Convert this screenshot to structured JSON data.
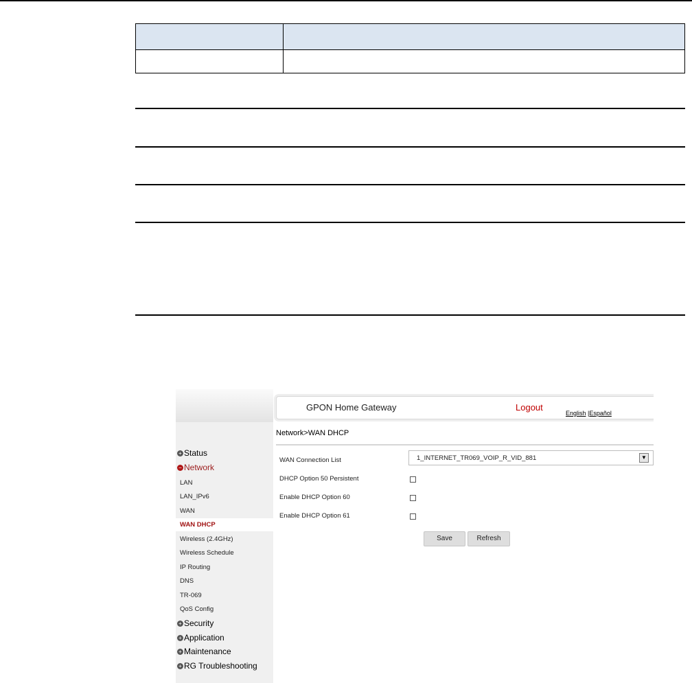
{
  "app": {
    "title": "GPON Home Gateway",
    "logout": "Logout",
    "lang_english": "English",
    "lang_sep": " |",
    "lang_espanol": "Español"
  },
  "breadcrumb": "Network>WAN DHCP",
  "nav": {
    "status": "Status",
    "network": "Network",
    "network_items": [
      "LAN",
      "LAN_IPv6",
      "WAN",
      "WAN DHCP",
      "Wireless (2.4GHz)",
      "Wireless Schedule",
      "IP Routing",
      "DNS",
      "TR-069",
      "QoS Config"
    ],
    "security": "Security",
    "application": "Application",
    "maintenance": "Maintenance",
    "rg_troubleshooting": "RG Troubleshooting"
  },
  "form": {
    "wan_connection_label": "WAN Connection List",
    "wan_connection_value": "1_INTERNET_TR069_VOIP_R_VID_881",
    "opt50_label": "DHCP Option 50 Persistent",
    "opt60_label": "Enable DHCP Option 60",
    "opt61_label": "Enable DHCP Option 61",
    "opt50_checked": false,
    "opt60_checked": false,
    "opt61_checked": false
  },
  "buttons": {
    "save": "Save",
    "refresh": "Refresh"
  },
  "colors": {
    "accent": "#c00000",
    "active_nav": "#a01212",
    "table_header": "#dbe5f1"
  }
}
